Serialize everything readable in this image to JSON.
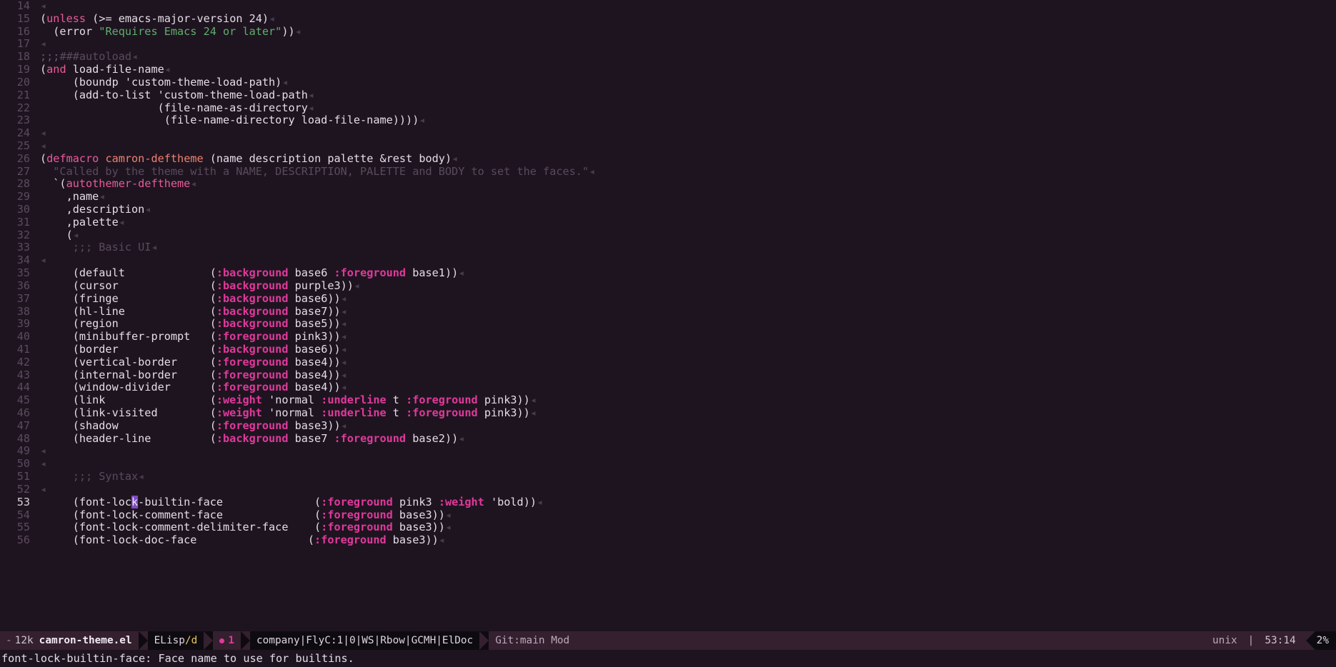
{
  "window": {
    "title": "camron-theme.el",
    "background": "#1e1420",
    "foreground": "#e4dce6",
    "cursor_color": "#7c4dbe",
    "accent_pink": "#e0399b",
    "accent_green": "#5fae6b",
    "accent_salmon": "#f0806f",
    "accent_yellow": "#e8c75b"
  },
  "buffer": {
    "first_visible_line": 14,
    "current_line": 53,
    "cursor_column": 14,
    "lines": [
      {
        "n": "14",
        "tokens": [
          {
            "t": "◂",
            "c": "eol"
          }
        ]
      },
      {
        "n": "15",
        "tokens": [
          {
            "t": "(",
            "c": "plain"
          },
          {
            "t": "unless",
            "c": "kw"
          },
          {
            "t": " (>= emacs-major-version 24)",
            "c": "plain"
          },
          {
            "t": "◂",
            "c": "eol"
          }
        ]
      },
      {
        "n": "16",
        "tokens": [
          {
            "t": "  (error ",
            "c": "plain"
          },
          {
            "t": "\"Requires Emacs 24 or later\"",
            "c": "str"
          },
          {
            "t": "))",
            "c": "plain"
          },
          {
            "t": "◂",
            "c": "eol"
          }
        ]
      },
      {
        "n": "17",
        "tokens": [
          {
            "t": "◂",
            "c": "eol"
          }
        ]
      },
      {
        "n": "18",
        "tokens": [
          {
            "t": ";;;",
            "c": "cmtd"
          },
          {
            "t": "###autoload",
            "c": "cmt"
          },
          {
            "t": "◂",
            "c": "eol"
          }
        ]
      },
      {
        "n": "19",
        "tokens": [
          {
            "t": "(",
            "c": "plain"
          },
          {
            "t": "and",
            "c": "kw"
          },
          {
            "t": " load-file-name",
            "c": "plain"
          },
          {
            "t": "◂",
            "c": "eol"
          }
        ]
      },
      {
        "n": "20",
        "tokens": [
          {
            "t": "     (boundp 'custom-theme-load-path)",
            "c": "plain"
          },
          {
            "t": "◂",
            "c": "eol"
          }
        ]
      },
      {
        "n": "21",
        "tokens": [
          {
            "t": "     (add-to-list 'custom-theme-load-path",
            "c": "plain"
          },
          {
            "t": "◂",
            "c": "eol"
          }
        ]
      },
      {
        "n": "22",
        "tokens": [
          {
            "t": "                  (file-name-as-directory",
            "c": "plain"
          },
          {
            "t": "◂",
            "c": "eol"
          }
        ]
      },
      {
        "n": "23",
        "tokens": [
          {
            "t": "                   (file-name-directory load-file-name))))",
            "c": "plain"
          },
          {
            "t": "◂",
            "c": "eol"
          }
        ]
      },
      {
        "n": "24",
        "tokens": [
          {
            "t": "◂",
            "c": "eol"
          }
        ]
      },
      {
        "n": "25",
        "tokens": [
          {
            "t": "◂",
            "c": "eol"
          }
        ]
      },
      {
        "n": "26",
        "tokens": [
          {
            "t": "(",
            "c": "plain"
          },
          {
            "t": "defmacro",
            "c": "kw"
          },
          {
            "t": " ",
            "c": "plain"
          },
          {
            "t": "camron-deftheme",
            "c": "fname"
          },
          {
            "t": " (name description palette &rest body)",
            "c": "plain"
          },
          {
            "t": "◂",
            "c": "eol"
          }
        ]
      },
      {
        "n": "27",
        "tokens": [
          {
            "t": "  \"Called by the theme with a NAME, DESCRIPTION, PALETTE and BODY to set the faces.\"",
            "c": "cmt"
          },
          {
            "t": "◂",
            "c": "eol"
          }
        ]
      },
      {
        "n": "28",
        "tokens": [
          {
            "t": "  `(",
            "c": "plain"
          },
          {
            "t": "autothemer-deftheme",
            "c": "kw"
          },
          {
            "t": "◂",
            "c": "eol"
          }
        ]
      },
      {
        "n": "29",
        "tokens": [
          {
            "t": "    ,name",
            "c": "plain"
          },
          {
            "t": "◂",
            "c": "eol"
          }
        ]
      },
      {
        "n": "30",
        "tokens": [
          {
            "t": "    ,description",
            "c": "plain"
          },
          {
            "t": "◂",
            "c": "eol"
          }
        ]
      },
      {
        "n": "31",
        "tokens": [
          {
            "t": "    ,palette",
            "c": "plain"
          },
          {
            "t": "◂",
            "c": "eol"
          }
        ]
      },
      {
        "n": "32",
        "tokens": [
          {
            "t": "    (",
            "c": "plain"
          },
          {
            "t": "◂",
            "c": "eol"
          }
        ]
      },
      {
        "n": "33",
        "tokens": [
          {
            "t": "     ;;; Basic UI",
            "c": "cmt"
          },
          {
            "t": "◂",
            "c": "eol"
          }
        ]
      },
      {
        "n": "34",
        "tokens": [
          {
            "t": "◂",
            "c": "eol"
          }
        ]
      },
      {
        "n": "35",
        "tokens": [
          {
            "t": "     (default             (",
            "c": "plain"
          },
          {
            "t": ":background",
            "c": "prop"
          },
          {
            "t": " base6 ",
            "c": "plain"
          },
          {
            "t": ":foreground",
            "c": "prop"
          },
          {
            "t": " base1))",
            "c": "plain"
          },
          {
            "t": "◂",
            "c": "eol"
          }
        ]
      },
      {
        "n": "36",
        "tokens": [
          {
            "t": "     (cursor              (",
            "c": "plain"
          },
          {
            "t": ":background",
            "c": "prop"
          },
          {
            "t": " purple3))",
            "c": "plain"
          },
          {
            "t": "◂",
            "c": "eol"
          }
        ]
      },
      {
        "n": "37",
        "tokens": [
          {
            "t": "     (fringe              (",
            "c": "plain"
          },
          {
            "t": ":background",
            "c": "prop"
          },
          {
            "t": " base6))",
            "c": "plain"
          },
          {
            "t": "◂",
            "c": "eol"
          }
        ]
      },
      {
        "n": "38",
        "tokens": [
          {
            "t": "     (hl-line             (",
            "c": "plain"
          },
          {
            "t": ":background",
            "c": "prop"
          },
          {
            "t": " base7))",
            "c": "plain"
          },
          {
            "t": "◂",
            "c": "eol"
          }
        ]
      },
      {
        "n": "39",
        "tokens": [
          {
            "t": "     (region              (",
            "c": "plain"
          },
          {
            "t": ":background",
            "c": "prop"
          },
          {
            "t": " base5))",
            "c": "plain"
          },
          {
            "t": "◂",
            "c": "eol"
          }
        ]
      },
      {
        "n": "40",
        "tokens": [
          {
            "t": "     (minibuffer-prompt   (",
            "c": "plain"
          },
          {
            "t": ":foreground",
            "c": "prop"
          },
          {
            "t": " pink3))",
            "c": "plain"
          },
          {
            "t": "◂",
            "c": "eol"
          }
        ]
      },
      {
        "n": "41",
        "tokens": [
          {
            "t": "     (border              (",
            "c": "plain"
          },
          {
            "t": ":background",
            "c": "prop"
          },
          {
            "t": " base6))",
            "c": "plain"
          },
          {
            "t": "◂",
            "c": "eol"
          }
        ]
      },
      {
        "n": "42",
        "tokens": [
          {
            "t": "     (vertical-border     (",
            "c": "plain"
          },
          {
            "t": ":foreground",
            "c": "prop"
          },
          {
            "t": " base4))",
            "c": "plain"
          },
          {
            "t": "◂",
            "c": "eol"
          }
        ]
      },
      {
        "n": "43",
        "tokens": [
          {
            "t": "     (internal-border     (",
            "c": "plain"
          },
          {
            "t": ":foreground",
            "c": "prop"
          },
          {
            "t": " base4))",
            "c": "plain"
          },
          {
            "t": "◂",
            "c": "eol"
          }
        ]
      },
      {
        "n": "44",
        "tokens": [
          {
            "t": "     (window-divider      (",
            "c": "plain"
          },
          {
            "t": ":foreground",
            "c": "prop"
          },
          {
            "t": " base4))",
            "c": "plain"
          },
          {
            "t": "◂",
            "c": "eol"
          }
        ]
      },
      {
        "n": "45",
        "tokens": [
          {
            "t": "     (link                (",
            "c": "plain"
          },
          {
            "t": ":weight",
            "c": "prop"
          },
          {
            "t": " 'normal ",
            "c": "plain"
          },
          {
            "t": ":underline",
            "c": "prop"
          },
          {
            "t": " t ",
            "c": "plain"
          },
          {
            "t": ":foreground",
            "c": "prop"
          },
          {
            "t": " pink3))",
            "c": "plain"
          },
          {
            "t": "◂",
            "c": "eol"
          }
        ]
      },
      {
        "n": "46",
        "tokens": [
          {
            "t": "     (link-visited        (",
            "c": "plain"
          },
          {
            "t": ":weight",
            "c": "prop"
          },
          {
            "t": " 'normal ",
            "c": "plain"
          },
          {
            "t": ":underline",
            "c": "prop"
          },
          {
            "t": " t ",
            "c": "plain"
          },
          {
            "t": ":foreground",
            "c": "prop"
          },
          {
            "t": " pink3))",
            "c": "plain"
          },
          {
            "t": "◂",
            "c": "eol"
          }
        ]
      },
      {
        "n": "47",
        "tokens": [
          {
            "t": "     (shadow              (",
            "c": "plain"
          },
          {
            "t": ":foreground",
            "c": "prop"
          },
          {
            "t": " base3))",
            "c": "plain"
          },
          {
            "t": "◂",
            "c": "eol"
          }
        ]
      },
      {
        "n": "48",
        "tokens": [
          {
            "t": "     (header-line         (",
            "c": "plain"
          },
          {
            "t": ":background",
            "c": "prop"
          },
          {
            "t": " base7 ",
            "c": "plain"
          },
          {
            "t": ":foreground",
            "c": "prop"
          },
          {
            "t": " base2))",
            "c": "plain"
          },
          {
            "t": "◂",
            "c": "eol"
          }
        ]
      },
      {
        "n": "49",
        "tokens": [
          {
            "t": "◂",
            "c": "eol"
          }
        ]
      },
      {
        "n": "50",
        "tokens": [
          {
            "t": "◂",
            "c": "eol"
          }
        ]
      },
      {
        "n": "51",
        "tokens": [
          {
            "t": "     ;;; Syntax",
            "c": "cmt"
          },
          {
            "t": "◂",
            "c": "eol"
          }
        ]
      },
      {
        "n": "52",
        "tokens": [
          {
            "t": "◂",
            "c": "eol"
          }
        ]
      },
      {
        "n": "53",
        "current": true,
        "tokens": [
          {
            "t": "     (font-loc",
            "c": "plain"
          },
          {
            "t": "k",
            "c": "cursor"
          },
          {
            "t": "-builtin-face              (",
            "c": "plain"
          },
          {
            "t": ":foreground",
            "c": "prop"
          },
          {
            "t": " pink3 ",
            "c": "plain"
          },
          {
            "t": ":weight",
            "c": "prop"
          },
          {
            "t": " 'bold))",
            "c": "plain"
          },
          {
            "t": "◂",
            "c": "eol"
          }
        ]
      },
      {
        "n": "54",
        "tokens": [
          {
            "t": "     (font-lock-comment-face              (",
            "c": "plain"
          },
          {
            "t": ":foreground",
            "c": "prop"
          },
          {
            "t": " base3))",
            "c": "plain"
          },
          {
            "t": "◂",
            "c": "eol"
          }
        ]
      },
      {
        "n": "55",
        "tokens": [
          {
            "t": "     (font-lock-comment-delimiter-face    (",
            "c": "plain"
          },
          {
            "t": ":foreground",
            "c": "prop"
          },
          {
            "t": " base3))",
            "c": "plain"
          },
          {
            "t": "◂",
            "c": "eol"
          }
        ]
      },
      {
        "n": "56",
        "tokens": [
          {
            "t": "     (font-lock-doc-face                 (",
            "c": "plain"
          },
          {
            "t": ":foreground",
            "c": "prop"
          },
          {
            "t": " base3))",
            "c": "plain"
          },
          {
            "t": "◂",
            "c": "eol"
          }
        ]
      }
    ]
  },
  "modeline": {
    "modified_indicator": "-",
    "buffer_size": "12k",
    "buffer_name": "camron-theme.el",
    "major_mode": "ELisp",
    "mode_slash": "/",
    "mode_suffix": "d",
    "error_count": "1",
    "minor_modes": "company|FlyC:1|0|WS|Rbow|GCMH|ElDoc",
    "vcs": "Git:main Mod",
    "encoding": "unix",
    "separator": "|",
    "position": "53:14",
    "scroll_percent": "2%"
  },
  "echo_area": {
    "message": "font-lock-builtin-face: Face name to use for builtins."
  }
}
